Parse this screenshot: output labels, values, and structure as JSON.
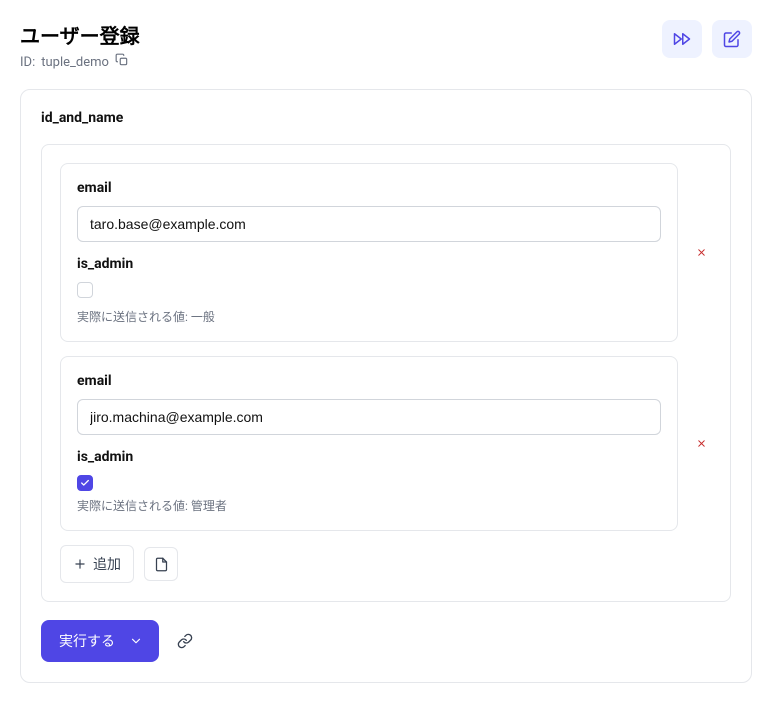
{
  "header": {
    "title": "ユーザー登録",
    "id_prefix": "ID:",
    "id_value": "tuple_demo"
  },
  "form": {
    "section_label": "id_and_name",
    "items": [
      {
        "email_label": "email",
        "email_value": "taro.base@example.com",
        "is_admin_label": "is_admin",
        "is_admin_checked": false,
        "hint": "実際に送信される値: 一般"
      },
      {
        "email_label": "email",
        "email_value": "jiro.machina@example.com",
        "is_admin_label": "is_admin",
        "is_admin_checked": true,
        "hint": "実際に送信される値: 管理者"
      }
    ],
    "add_label": "追加"
  },
  "footer": {
    "submit_label": "実行する"
  }
}
